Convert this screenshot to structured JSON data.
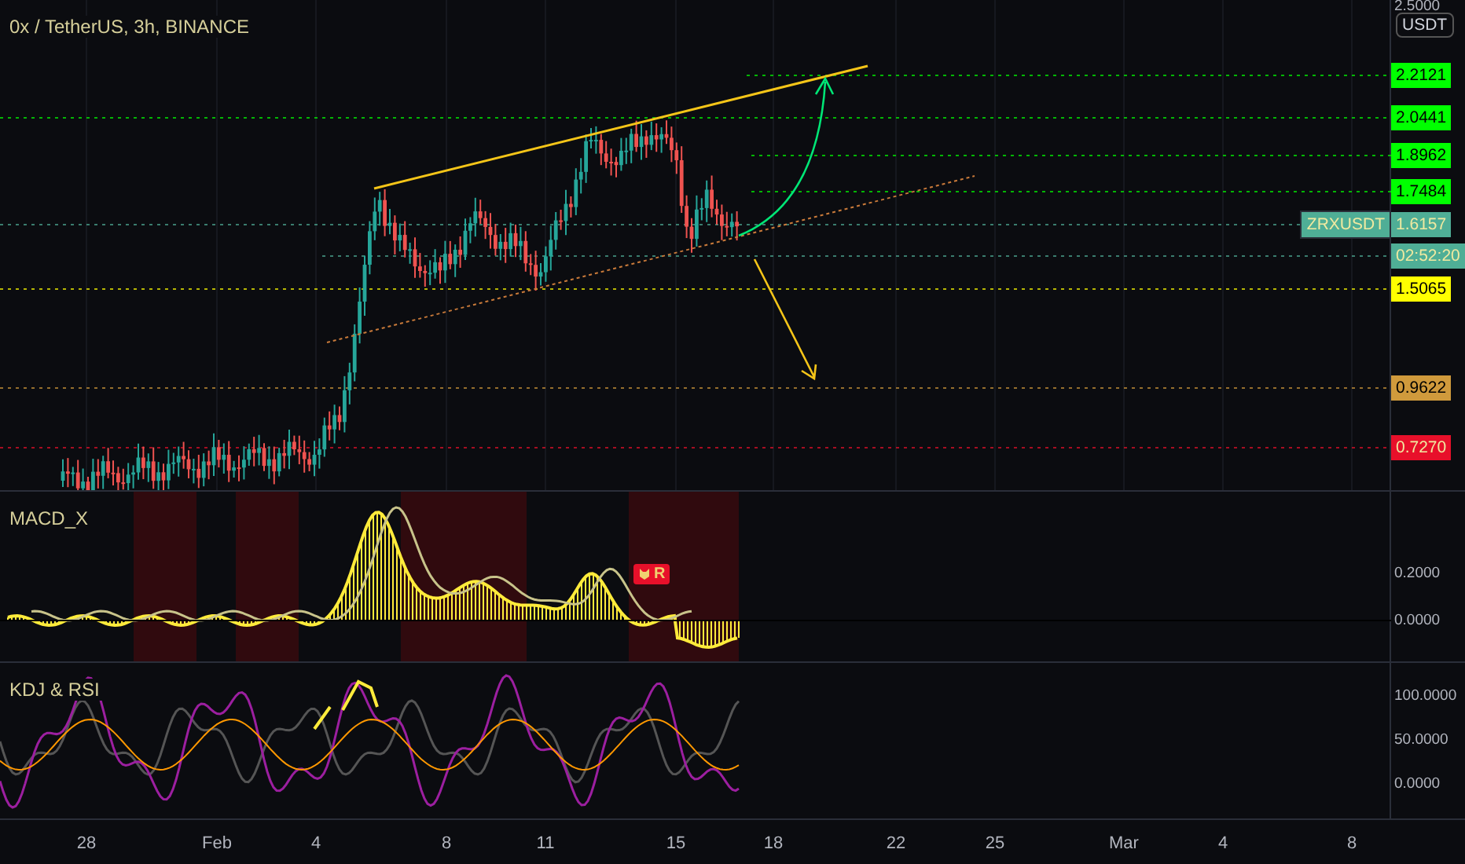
{
  "header": {
    "title": "0x / TetherUS, 3h, BINANCE"
  },
  "price_axis": {
    "top_tick": "2.5000",
    "currency": "USDT",
    "tags": [
      {
        "kind": "price",
        "text": "2.2121",
        "color": "#00ff00"
      },
      {
        "kind": "price",
        "text": "2.0441",
        "color": "#00ff00"
      },
      {
        "kind": "price",
        "text": "1.8962",
        "color": "#00ff00"
      },
      {
        "kind": "price",
        "text": "1.7484",
        "color": "#00ff00"
      },
      {
        "kind": "symbol",
        "symbol": "ZRXUSDT",
        "text": "1.6157",
        "color": "#4fae96"
      },
      {
        "kind": "countdown",
        "text": "02:52:20",
        "color": "#4fae96"
      },
      {
        "kind": "price",
        "text": "1.5065",
        "color": "#ffff00"
      },
      {
        "kind": "price",
        "text": "0.9622",
        "color": "#d09a3c"
      },
      {
        "kind": "price",
        "text": "0.7270",
        "color": "#e8102a"
      }
    ]
  },
  "macd": {
    "title": "MACD_X",
    "badge": "R",
    "ticks": [
      "0.2000",
      "0.0000"
    ]
  },
  "kdj": {
    "title": "KDJ & RSI",
    "ticks": [
      "100.0000",
      "50.0000",
      "0.0000"
    ]
  },
  "x_axis": {
    "labels": [
      "28",
      "Feb",
      "4",
      "8",
      "11",
      "15",
      "18",
      "22",
      "25",
      "Mar",
      "4",
      "8"
    ]
  }
}
